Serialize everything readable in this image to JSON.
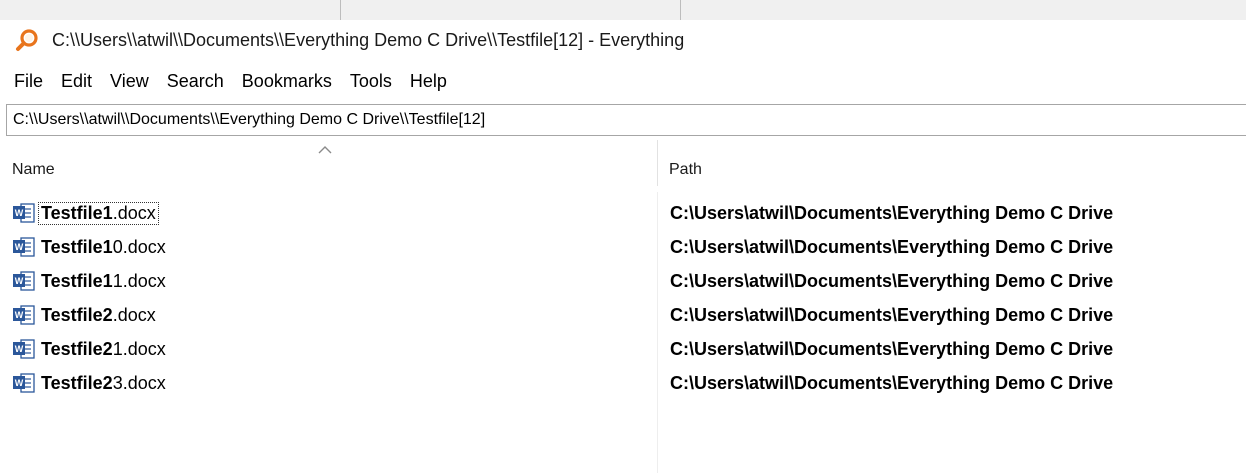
{
  "window": {
    "title": "C:\\\\Users\\\\atwil\\\\Documents\\\\Everything Demo C Drive\\\\Testfile[12] - Everything",
    "app_icon": "magnifier-icon",
    "accent_color": "#e8741c"
  },
  "menu": {
    "items": [
      "File",
      "Edit",
      "View",
      "Search",
      "Bookmarks",
      "Tools",
      "Help"
    ]
  },
  "search": {
    "value": "C:\\\\Users\\\\atwil\\\\Documents\\\\Everything Demo C Drive\\\\Testfile[12]"
  },
  "columns": {
    "name": "Name",
    "path": "Path",
    "sort_indicator": "ascending"
  },
  "results": [
    {
      "name_bold": "Testfile1",
      "name_rest": ".docx",
      "path": "C:\\Users\\atwil\\Documents\\Everything Demo C Drive",
      "icon": "word-document-icon",
      "focused": true
    },
    {
      "name_bold": "Testfile1",
      "name_mid": "0",
      "name_rest": ".docx",
      "path": "C:\\Users\\atwil\\Documents\\Everything Demo C Drive",
      "icon": "word-document-icon"
    },
    {
      "name_bold": "Testfile1",
      "name_mid": "1",
      "name_rest": ".docx",
      "path": "C:\\Users\\atwil\\Documents\\Everything Demo C Drive",
      "icon": "word-document-icon"
    },
    {
      "name_bold": "Testfile2",
      "name_rest": ".docx",
      "path": "C:\\Users\\atwil\\Documents\\Everything Demo C Drive",
      "icon": "word-document-icon"
    },
    {
      "name_bold": "Testfile2",
      "name_mid": "1",
      "name_rest": ".docx",
      "path": "C:\\Users\\atwil\\Documents\\Everything Demo C Drive",
      "icon": "word-document-icon"
    },
    {
      "name_bold": "Testfile2",
      "name_mid": "3",
      "name_rest": ".docx",
      "path": "C:\\Users\\atwil\\Documents\\Everything Demo C Drive",
      "icon": "word-document-icon"
    }
  ]
}
